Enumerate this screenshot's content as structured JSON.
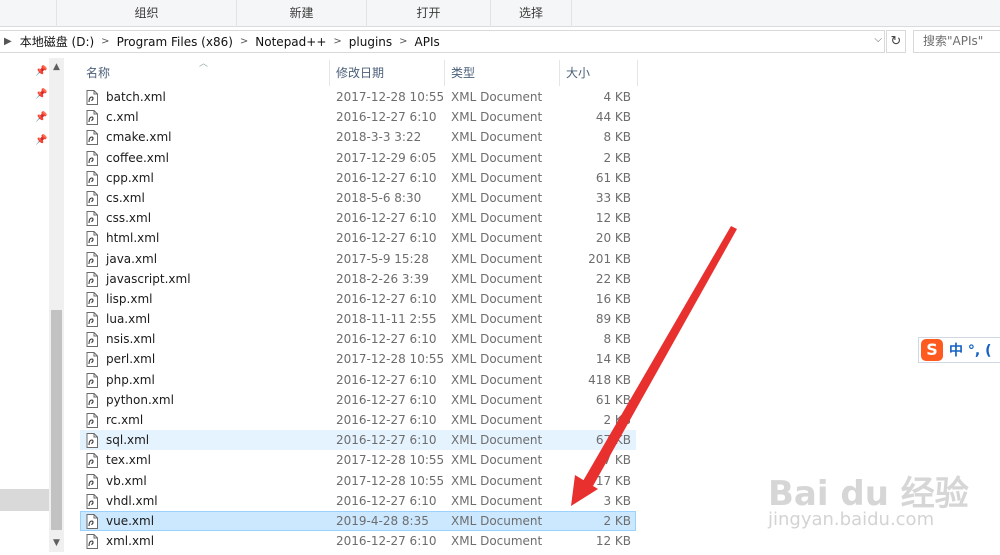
{
  "ribbon": {
    "groups": [
      "组织",
      "新建",
      "打开",
      "选择"
    ]
  },
  "address": {
    "breadcrumb": [
      "本地磁盘 (D:)",
      "Program Files (x86)",
      "Notepad++",
      "plugins",
      "APIs"
    ],
    "search_placeholder": "搜索\"APIs\""
  },
  "columns": {
    "name": "名称",
    "date": "修改日期",
    "type": "类型",
    "size": "大小"
  },
  "files": [
    {
      "name": "batch.xml",
      "date": "2017-12-28 10:55",
      "type": "XML Document",
      "size": "4 KB"
    },
    {
      "name": "c.xml",
      "date": "2016-12-27 6:10",
      "type": "XML Document",
      "size": "44 KB"
    },
    {
      "name": "cmake.xml",
      "date": "2018-3-3 3:22",
      "type": "XML Document",
      "size": "8 KB"
    },
    {
      "name": "coffee.xml",
      "date": "2017-12-29 6:05",
      "type": "XML Document",
      "size": "2 KB"
    },
    {
      "name": "cpp.xml",
      "date": "2016-12-27 6:10",
      "type": "XML Document",
      "size": "61 KB"
    },
    {
      "name": "cs.xml",
      "date": "2018-5-6 8:30",
      "type": "XML Document",
      "size": "33 KB"
    },
    {
      "name": "css.xml",
      "date": "2016-12-27 6:10",
      "type": "XML Document",
      "size": "12 KB"
    },
    {
      "name": "html.xml",
      "date": "2016-12-27 6:10",
      "type": "XML Document",
      "size": "20 KB"
    },
    {
      "name": "java.xml",
      "date": "2017-5-9 15:28",
      "type": "XML Document",
      "size": "201 KB"
    },
    {
      "name": "javascript.xml",
      "date": "2018-2-26 3:39",
      "type": "XML Document",
      "size": "22 KB"
    },
    {
      "name": "lisp.xml",
      "date": "2016-12-27 6:10",
      "type": "XML Document",
      "size": "16 KB"
    },
    {
      "name": "lua.xml",
      "date": "2018-11-11 2:55",
      "type": "XML Document",
      "size": "89 KB"
    },
    {
      "name": "nsis.xml",
      "date": "2016-12-27 6:10",
      "type": "XML Document",
      "size": "8 KB"
    },
    {
      "name": "perl.xml",
      "date": "2017-12-28 10:55",
      "type": "XML Document",
      "size": "14 KB"
    },
    {
      "name": "php.xml",
      "date": "2016-12-27 6:10",
      "type": "XML Document",
      "size": "418 KB"
    },
    {
      "name": "python.xml",
      "date": "2016-12-27 6:10",
      "type": "XML Document",
      "size": "61 KB"
    },
    {
      "name": "rc.xml",
      "date": "2016-12-27 6:10",
      "type": "XML Document",
      "size": "2 KB"
    },
    {
      "name": "sql.xml",
      "date": "2016-12-27 6:10",
      "type": "XML Document",
      "size": "67 KB",
      "state": "hover"
    },
    {
      "name": "tex.xml",
      "date": "2017-12-28 10:55",
      "type": "XML Document",
      "size": "7 KB"
    },
    {
      "name": "vb.xml",
      "date": "2017-12-28 10:55",
      "type": "XML Document",
      "size": "17 KB"
    },
    {
      "name": "vhdl.xml",
      "date": "2016-12-27 6:10",
      "type": "XML Document",
      "size": "3 KB"
    },
    {
      "name": "vue.xml",
      "date": "2019-4-28 8:35",
      "type": "XML Document",
      "size": "2 KB",
      "state": "selected"
    },
    {
      "name": "xml.xml",
      "date": "2016-12-27 6:10",
      "type": "XML Document",
      "size": "12 KB"
    }
  ],
  "ime": {
    "logo": "S",
    "text": "中 °, ("
  },
  "watermark": {
    "brand": "Bai du 经验",
    "url": "jingyan.baidu.com"
  },
  "colors": {
    "selected_bg": "#cce8ff",
    "hover_bg": "#e5f3ff",
    "arrow": "#e8312f",
    "ime_logo": "#ff5a1f"
  }
}
